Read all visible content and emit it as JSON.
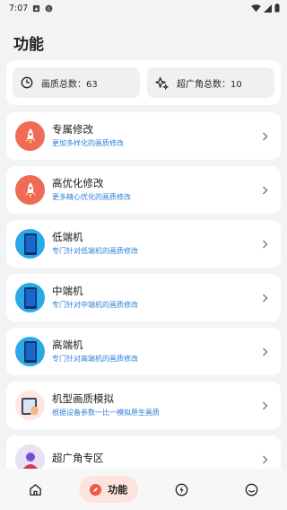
{
  "status_bar": {
    "time": "7:07"
  },
  "page": {
    "title": "功能"
  },
  "stats": [
    {
      "label": "画质总数：",
      "value": "63",
      "icon": "clock-icon"
    },
    {
      "label": "超广角总数：",
      "value": "10",
      "icon": "sparkle-icon"
    }
  ],
  "items": [
    {
      "title": "专属修改",
      "subtitle": "更加多样化的画质修改",
      "icon": "rocket-icon"
    },
    {
      "title": "高优化修改",
      "subtitle": "更多精心优化的画质修改",
      "icon": "rocket-icon"
    },
    {
      "title": "低端机",
      "subtitle": "专门针对低端机的画质修改",
      "icon": "phone-icon"
    },
    {
      "title": "中端机",
      "subtitle": "专门针对中端机的画质修改",
      "icon": "phone-icon"
    },
    {
      "title": "高端机",
      "subtitle": "专门针对高端机的画质修改",
      "icon": "phone-icon"
    },
    {
      "title": "机型画质模拟",
      "subtitle": "根据设备参数一比一模拟原生画质",
      "icon": "tablet-icon"
    },
    {
      "title": "超广角专区",
      "subtitle": "",
      "icon": "wide-angle-icon"
    }
  ],
  "nav": {
    "active_label": "功能",
    "items": [
      "home-icon",
      "compass-icon",
      "bolt-icon",
      "smile-icon"
    ]
  },
  "colors": {
    "accent": "#ef6b55",
    "link": "#2f7fd6",
    "active_nav_bg": "#fde3dd"
  }
}
